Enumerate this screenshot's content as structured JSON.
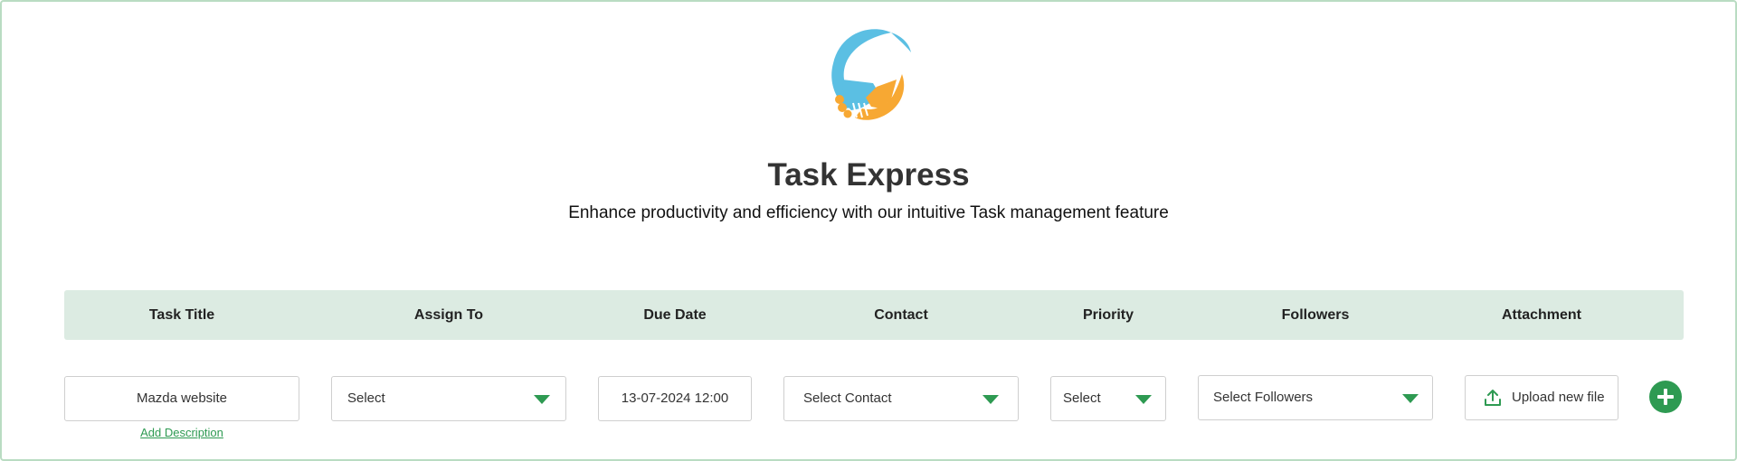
{
  "app": {
    "title": "Task Express",
    "subtitle": "Enhance productivity and efficiency with our intuitive Task management feature",
    "logo_icon": "handshake-circle-logo"
  },
  "table": {
    "headers": [
      "Task Title",
      "Assign To",
      "Due Date",
      "Contact",
      "Priority",
      "Followers",
      "Attachment"
    ]
  },
  "form": {
    "task_title": "Mazda website",
    "add_description_label": "Add Description",
    "assign_to": "Select",
    "due_date": "13-07-2024 12:00",
    "contact": "Select Contact",
    "priority": "Select",
    "followers": "Select Followers",
    "attachment_label": "Upload new file",
    "add_icon": "plus-circle-icon"
  },
  "colors": {
    "accent": "#2e9a52",
    "header_bg": "#dcebe2",
    "border": "#b9dcc2",
    "logo_blue": "#5bbfe3",
    "logo_orange": "#f7a833"
  }
}
